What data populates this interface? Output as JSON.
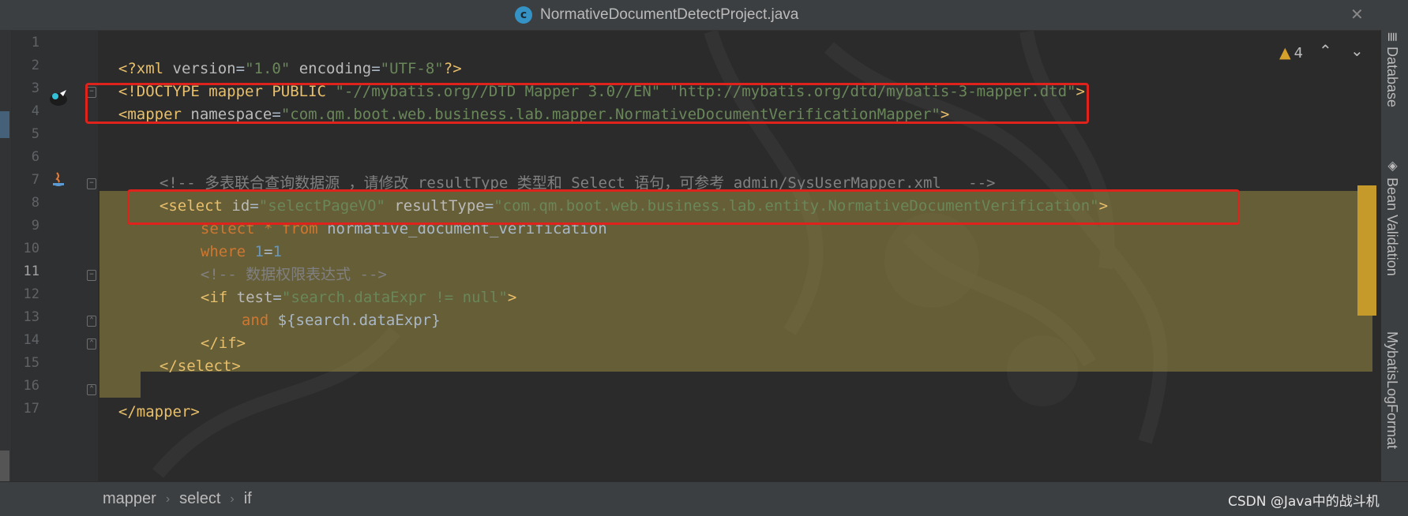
{
  "tab": {
    "icon_letter": "c",
    "title": "NormativeDocumentDetectProject.java",
    "close_glyph": "✕"
  },
  "inspections": {
    "warning_count": "4",
    "up_glyph": "⌃",
    "down_glyph": "⌄"
  },
  "line_numbers": [
    "1",
    "2",
    "3",
    "4",
    "5",
    "6",
    "7",
    "8",
    "9",
    "10",
    "11",
    "12",
    "13",
    "14",
    "15",
    "16",
    "17"
  ],
  "code": {
    "l1": {
      "a": "<?xml ",
      "b": "version",
      "c": "=",
      "d": "\"1.0\"",
      "e": " encoding",
      "f": "=",
      "g": "\"UTF-8\"",
      "h": "?>"
    },
    "l2": {
      "a": "<!DOCTYPE ",
      "b": "mapper PUBLIC ",
      "c": "\"-//mybatis.org//DTD Mapper 3.0//EN\"",
      "d": " ",
      "e": "\"http://mybatis.org/dtd/mybatis-3-mapper.dtd\"",
      "f": ">"
    },
    "l3": {
      "a": "<mapper ",
      "b": "namespace",
      "c": "=",
      "d": "\"com.qm.boot.web.business.lab.mapper.NormativeDocumentVerificationMapper\"",
      "e": ">"
    },
    "l6": {
      "a": "<!-- 多表联合查询数据源 ，请修改 resultType 类型和 Select 语句，可参考 admin/SysUserMapper.xml   -->"
    },
    "l7": {
      "a": "<select ",
      "b": "id",
      "c": "=",
      "d": "\"selectPageVO\"",
      "e": " resultType",
      "f": "=",
      "g": "\"com.qm.boot.web.business.lab.entity.NormativeDocumentVerification\"",
      "h": ">"
    },
    "l8": {
      "a": "select ",
      "b": "* ",
      "c": "from ",
      "d": "normative_document_verification"
    },
    "l9": {
      "a": "where ",
      "b": "1",
      "c": "=",
      "d": "1"
    },
    "l10": {
      "a": "<!-- 数据权限表达式 -->"
    },
    "l11": {
      "a": "<if ",
      "b": "test",
      "c": "=",
      "d": "\"search.dataExpr != null\"",
      "e": ">"
    },
    "l12": {
      "a": "and ",
      "b": "${search.dataExpr}"
    },
    "l13": {
      "a": "</if>"
    },
    "l14": {
      "a": "</select>"
    },
    "l16": {
      "a": "</mapper>"
    }
  },
  "side_tabs": {
    "database": "Database",
    "bean_validation": "Bean Validation",
    "mybatis_log": "MybatisLogFormat"
  },
  "breadcrumb": [
    "mapper",
    "select",
    "if"
  ],
  "watermark": "CSDN @Java中的战斗机",
  "colors": {
    "highlight_box": "#e0221c",
    "selection": "#a89746",
    "warning": "#d6a12a",
    "tag": "#e8bf6a",
    "string": "#6a8759",
    "keyword": "#cc7832",
    "number": "#6897bb",
    "comment": "#808080"
  }
}
